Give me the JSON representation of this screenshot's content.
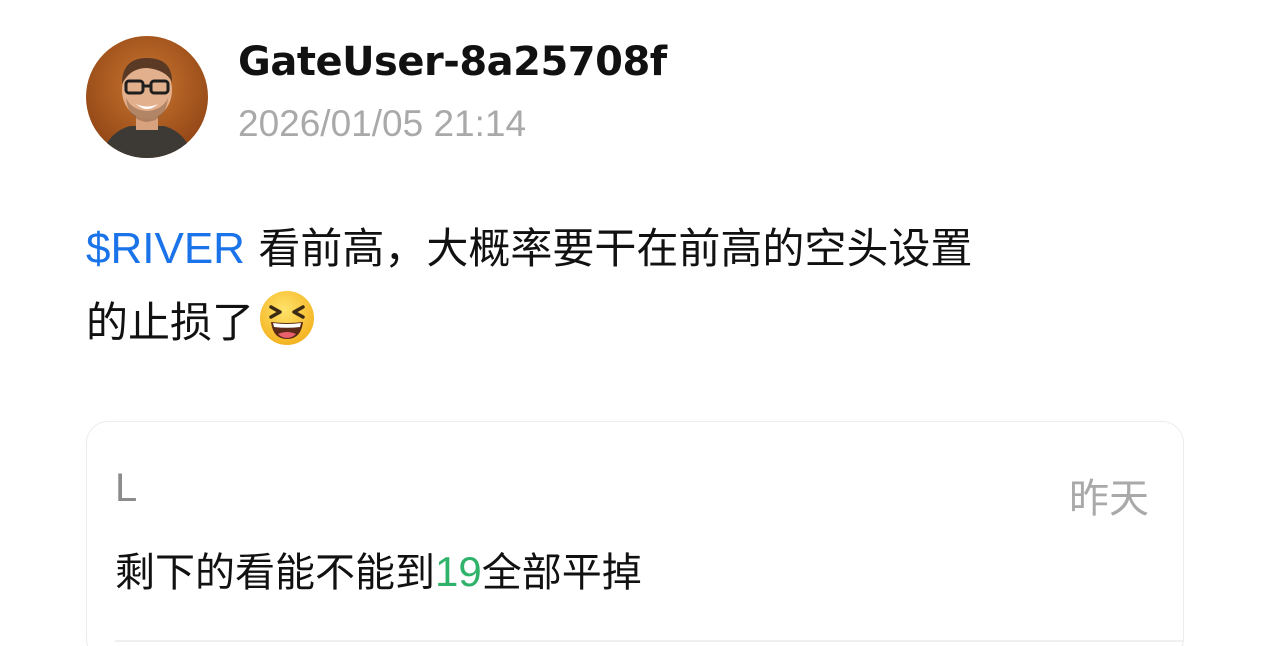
{
  "post": {
    "author": {
      "username": "GateUser-8a25708f",
      "avatar_icon": "user-avatar-photo"
    },
    "timestamp": "2026/01/05 21:14",
    "ticker": "$RIVER",
    "text_line1": "看前高，大概率要干在前高的空头设置",
    "text_line2": "的止损了",
    "emoji": "laughing-emoji",
    "colors": {
      "ticker": "#1a73e8"
    }
  },
  "reply": {
    "author": "L",
    "time": "昨天",
    "text_before": "剩下的看能不能到",
    "number": "19",
    "text_after": "全部平掉",
    "colors": {
      "number": "#2fb36a"
    }
  }
}
